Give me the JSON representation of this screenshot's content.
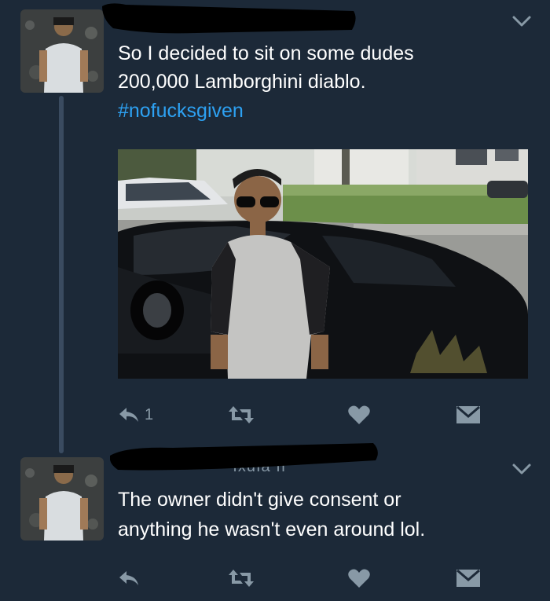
{
  "tweet1": {
    "text_line1": "So I decided to sit on some dudes",
    "text_line2": "200,000 Lamborghini diablo.",
    "hashtag": "#nofucksgiven",
    "actions": {
      "reply_count": "1"
    },
    "icons": [
      "reply-icon",
      "retweet-icon",
      "like-icon",
      "dm-icon",
      "chevron-down-icon"
    ]
  },
  "tweet2": {
    "name_visible_fragment": "·····ıxuıa ıı",
    "text_line1": "The owner didn't give consent or",
    "text_line2": "anything he wasn't even around lol.",
    "icons": [
      "reply-icon",
      "retweet-icon",
      "like-icon",
      "dm-icon",
      "chevron-down-icon"
    ]
  },
  "colors": {
    "background": "#1c2938",
    "text": "#ffffff",
    "hashtag": "#2da1f2",
    "icon": "#8899a6",
    "thread_line": "#3a4b60"
  }
}
